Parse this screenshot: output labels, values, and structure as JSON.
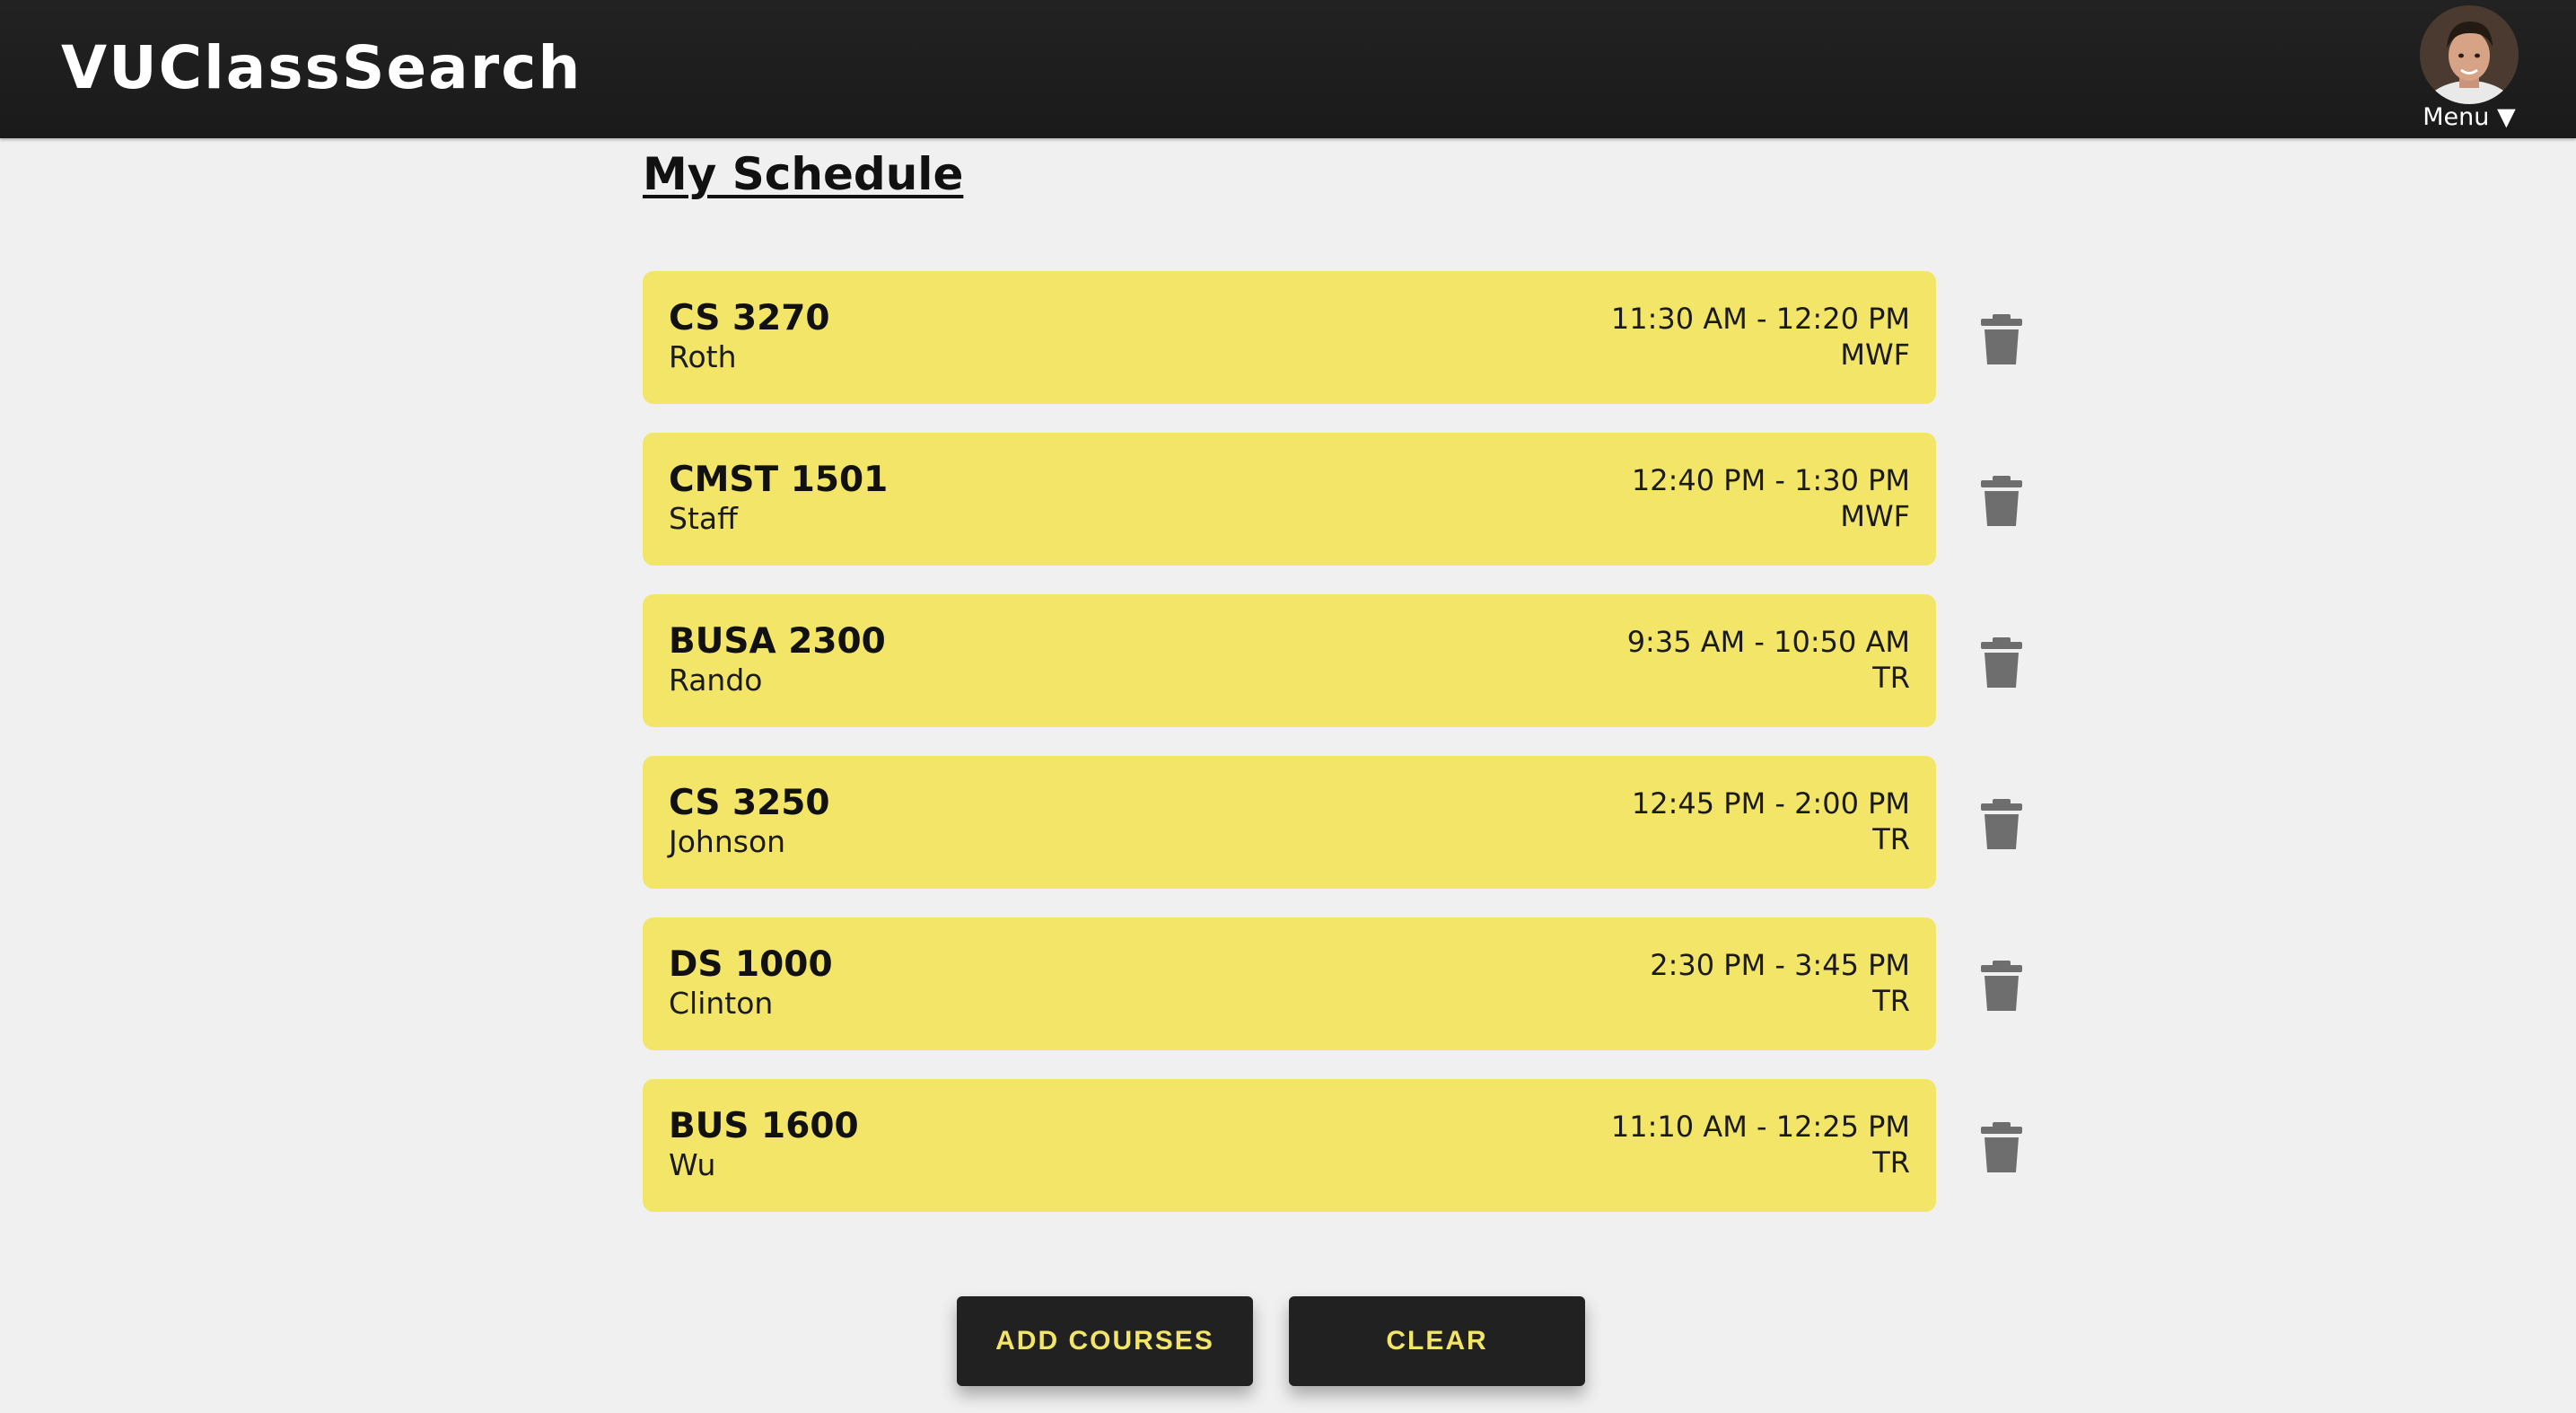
{
  "header": {
    "brand": "VUClassSearch",
    "menu_label": "Menu ▼"
  },
  "page": {
    "title": "My Schedule"
  },
  "courses": [
    {
      "code": "CS 3270",
      "instructor": "Roth",
      "time": "11:30 AM - 12:20 PM",
      "days": "MWF"
    },
    {
      "code": "CMST 1501",
      "instructor": "Staff",
      "time": "12:40 PM - 1:30 PM",
      "days": "MWF"
    },
    {
      "code": "BUSA 2300",
      "instructor": "Rando",
      "time": "9:35 AM - 10:50 AM",
      "days": "TR"
    },
    {
      "code": "CS 3250",
      "instructor": "Johnson",
      "time": "12:45 PM - 2:00 PM",
      "days": "TR"
    },
    {
      "code": "DS 1000",
      "instructor": "Clinton",
      "time": "2:30 PM - 3:45 PM",
      "days": "TR"
    },
    {
      "code": "BUS 1600",
      "instructor": "Wu",
      "time": "11:10 AM - 12:25 PM",
      "days": "TR"
    }
  ],
  "actions": {
    "add_label": "ADD COURSES",
    "clear_label": "CLEAR"
  },
  "colors": {
    "header_bg": "#1f1f1f",
    "page_bg": "#f0f0f0",
    "card_bg": "#f2e567",
    "button_bg": "#212121",
    "button_text": "#f2e567",
    "trash_icon": "#6e6e6e"
  },
  "icons": {
    "delete": "trash-icon",
    "avatar": "user-avatar"
  }
}
